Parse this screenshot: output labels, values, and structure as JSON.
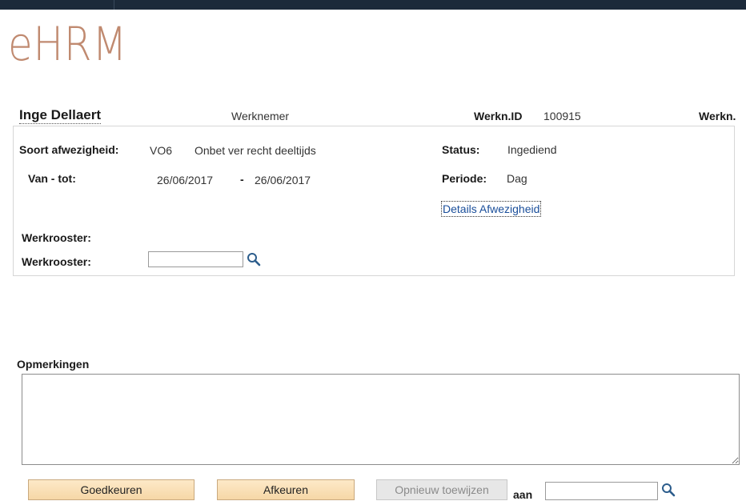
{
  "app": {
    "logo": "eHRM"
  },
  "header": {
    "employee_name": "Inge Dellaert",
    "role": "Werknemer",
    "id_label": "Werkn.ID",
    "id_value": "100915",
    "extra_label": "Werkn."
  },
  "details": {
    "absence_type_label": "Soort afwezigheid:",
    "absence_code": "VO6",
    "absence_desc": "Onbet ver recht deeltijds",
    "status_label": "Status:",
    "status_value": "Ingediend",
    "range_label": "Van - tot:",
    "from_date": "26/06/2017",
    "range_sep": "-",
    "to_date": "26/06/2017",
    "period_label": "Periode:",
    "period_value": "Dag",
    "details_link": "Details Afwezigheid",
    "schedule_label_1": "Werkrooster:",
    "schedule_label_2": "Werkrooster:",
    "schedule_input_value": ""
  },
  "comments": {
    "label": "Opmerkingen",
    "value": ""
  },
  "actions": {
    "approve": "Goedkeuren",
    "reject": "Afkeuren",
    "reassign": "Opnieuw toewijzen",
    "to_label": "aan",
    "to_input_value": ""
  },
  "icons": {
    "lookup": "magnifier-icon"
  },
  "colors": {
    "logo": "#c08a70",
    "button_bg": "#f6d7a6",
    "link": "#1a4e9a",
    "topbar": "#1c2a3a"
  }
}
